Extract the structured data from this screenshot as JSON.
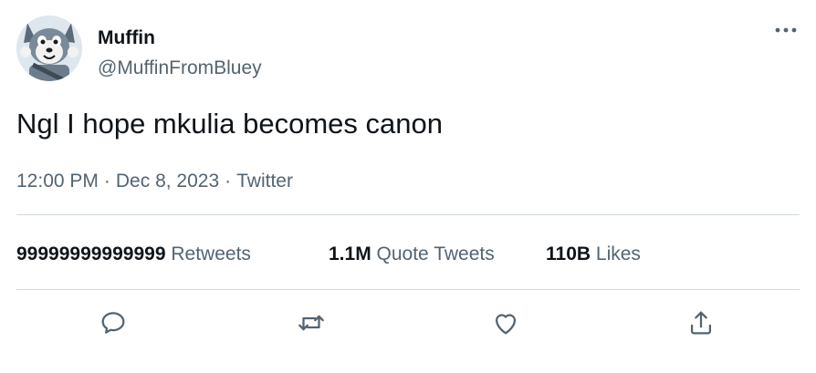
{
  "author": {
    "display_name": "Muffin",
    "handle": "@MuffinFromBluey",
    "avatar_icon": "cartoon-dog-avatar"
  },
  "more_icon": "more-options-icon",
  "tweet": {
    "text": "Ngl I hope mkulia becomes canon",
    "time": "12:00 PM",
    "date": "Dec 8, 2023",
    "source": "Twitter",
    "separator": "·"
  },
  "stats": {
    "retweets_count": "99999999999999",
    "retweets_label": "Retweets",
    "quotes_count": "1.1M",
    "quotes_label": "Quote Tweets",
    "likes_count": "110B",
    "likes_label": "Likes"
  },
  "actions": [
    "reply-icon",
    "retweet-icon",
    "like-icon",
    "share-icon"
  ],
  "colors": {
    "text_primary": "#0f1419",
    "text_secondary": "#536471",
    "divider": "#cfd9de",
    "action_icon": "#536471"
  }
}
